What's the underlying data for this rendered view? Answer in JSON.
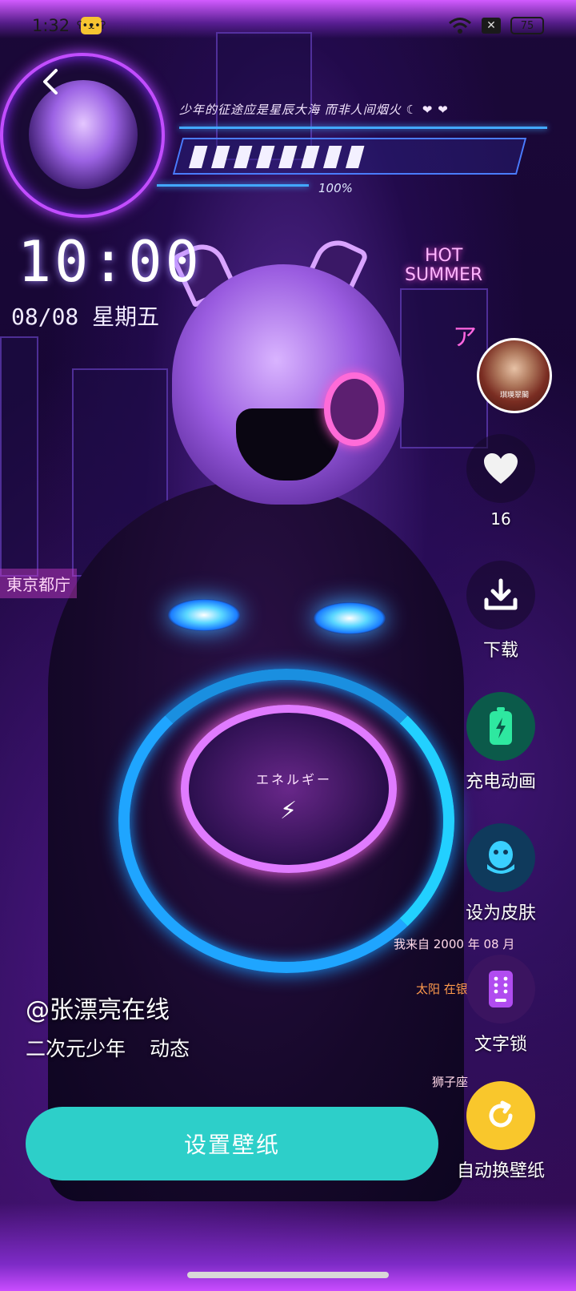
{
  "status_bar": {
    "time": "1:32",
    "app_icon_text": "ʕ•ᴥ•ʔ",
    "battery": "75"
  },
  "wallpaper_text": {
    "tagline": "少年的征途应是星辰大海 而非人间烟火 ☾ ❤ ❤",
    "progress_pct": "100%",
    "progress_value": 1.0,
    "clock": "10:00",
    "date": "08/08 星期五",
    "hot_summer_line1": "HOT",
    "hot_summer_line2": "SUMMER",
    "tokyo_sign": "東京都庁",
    "energy": "エネルギー",
    "born_text": "我来自 2000 年 08 月",
    "sun_text": "太阳 在银河中守护",
    "zodiac_text": "狮子座",
    "side_text": "ア"
  },
  "actions": {
    "author_avatar_tag": "琪瑛翠閣",
    "like_count": "16",
    "download_label": "下载",
    "charge_label": "充电动画",
    "skin_label": "设为皮肤",
    "text_lock_label": "文字锁",
    "auto_change_label": "自动换壁纸"
  },
  "info": {
    "author": "@张漂亮在线",
    "tags": [
      "二次元少年",
      "动态"
    ]
  },
  "main_button": {
    "label": "设置壁纸"
  },
  "colors": {
    "primary_button": "#2dcfc9",
    "auto_button": "#f9c72c",
    "charge_icon": "#2ee8a0",
    "skin_icon": "#3ad0ff",
    "text_lock_icon": "#b14cf0"
  },
  "icons": {
    "back": "chevron-left-icon",
    "like": "heart-icon",
    "download": "download-icon",
    "charge": "battery-charging-icon",
    "skin": "qq-penguin-icon",
    "text_lock": "keypad-phone-icon",
    "auto_change": "refresh-icon"
  }
}
